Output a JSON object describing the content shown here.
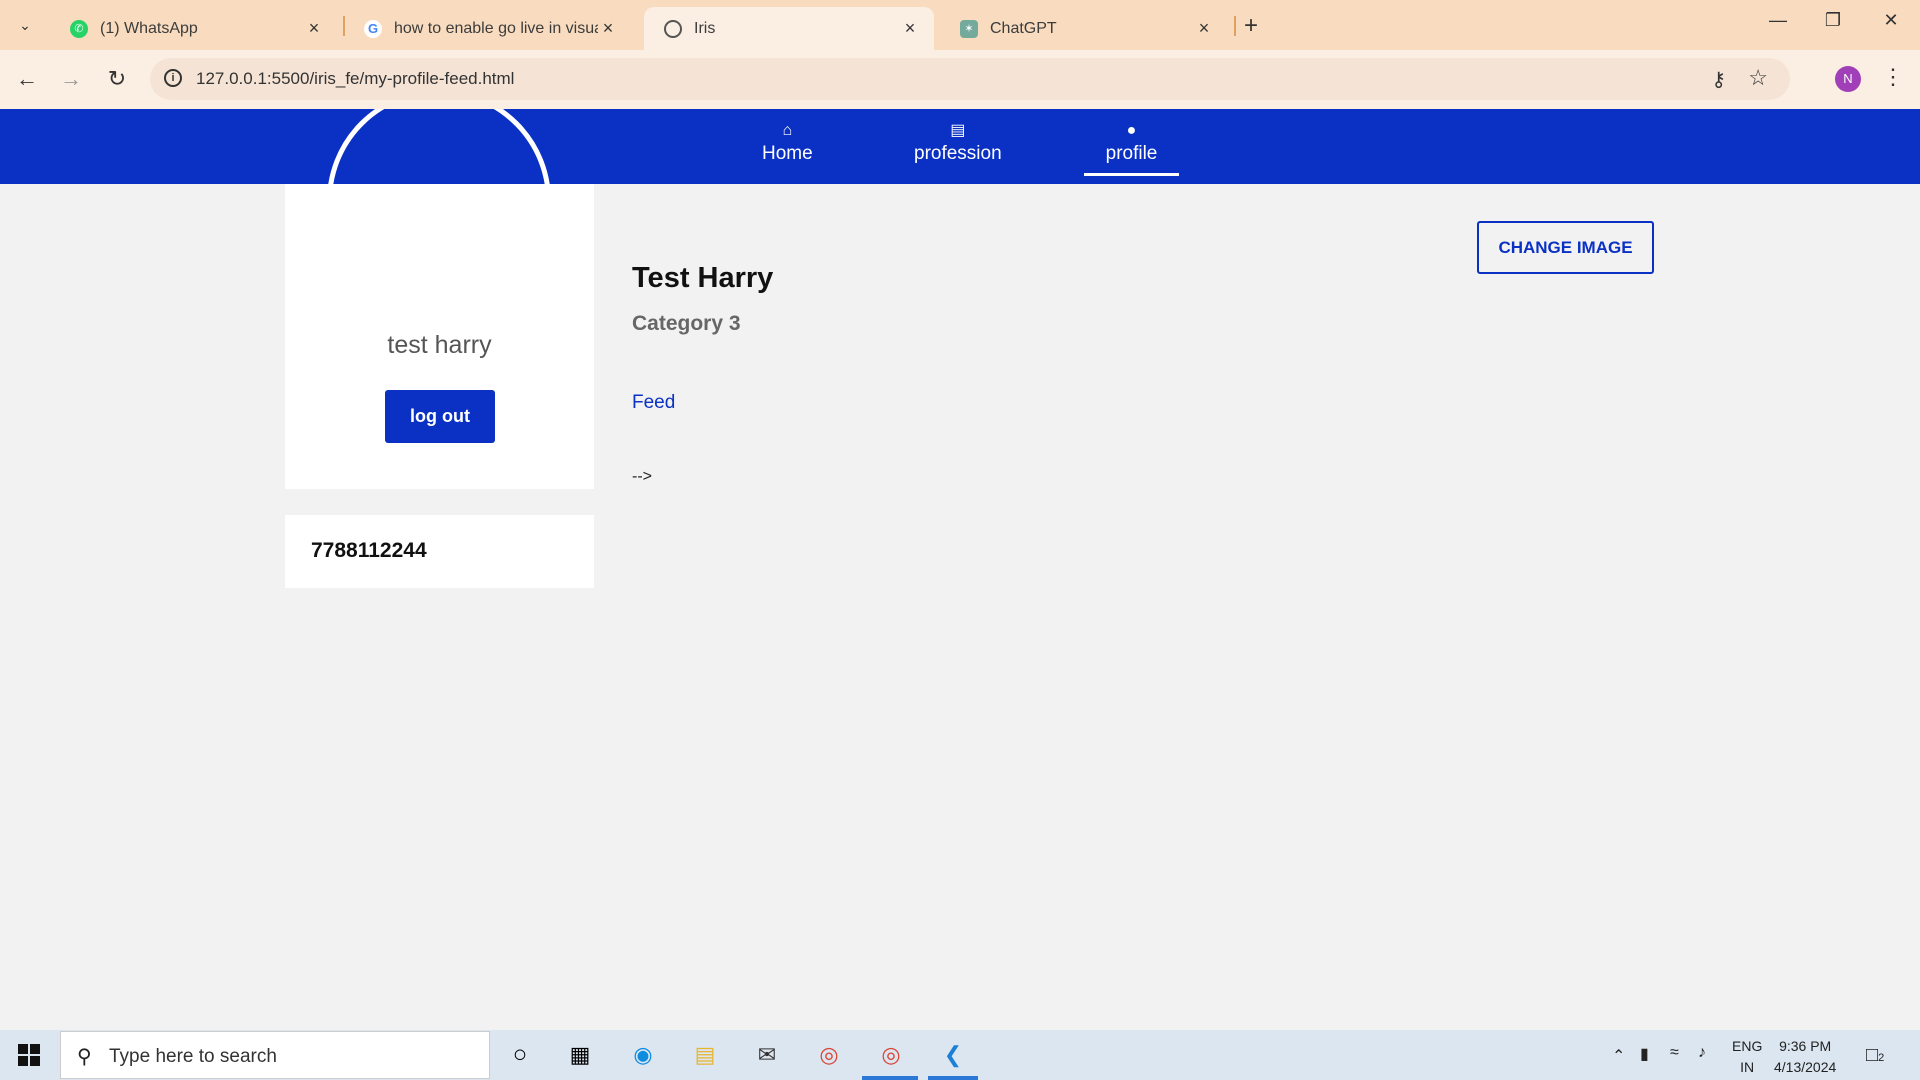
{
  "browser": {
    "tabs": [
      {
        "title": "(1) WhatsApp",
        "favicon": "whatsapp-icon",
        "active": false
      },
      {
        "title": "how to enable go live in visual s",
        "favicon": "google-icon",
        "active": false
      },
      {
        "title": "Iris",
        "favicon": "globe-icon",
        "active": true
      },
      {
        "title": "ChatGPT",
        "favicon": "chatgpt-icon",
        "active": false
      }
    ],
    "url": "127.0.0.1:5500/iris_fe/my-profile-feed.html",
    "profile_initial": "N"
  },
  "app": {
    "colors": {
      "primary": "#0a31c4",
      "background": "#f2f2f2"
    },
    "nav": [
      {
        "label": "Home",
        "icon": "home-icon",
        "active": false
      },
      {
        "label": "profession",
        "icon": "briefcase-icon",
        "active": false
      },
      {
        "label": "profile",
        "icon": "user-icon",
        "active": true
      }
    ],
    "profile_card": {
      "name": "test harry",
      "logout_label": "log out"
    },
    "phone": "7788112244",
    "main": {
      "title": "Test Harry",
      "category": "Category 3",
      "feed_link": "Feed",
      "stray_text": "-->",
      "change_image_label": "CHANGE IMAGE"
    }
  },
  "taskbar": {
    "search_placeholder": "Type here to search",
    "lang_line1": "ENG",
    "lang_line2": "IN",
    "time": "9:36 PM",
    "date": "4/13/2024",
    "notification_count": "2"
  }
}
